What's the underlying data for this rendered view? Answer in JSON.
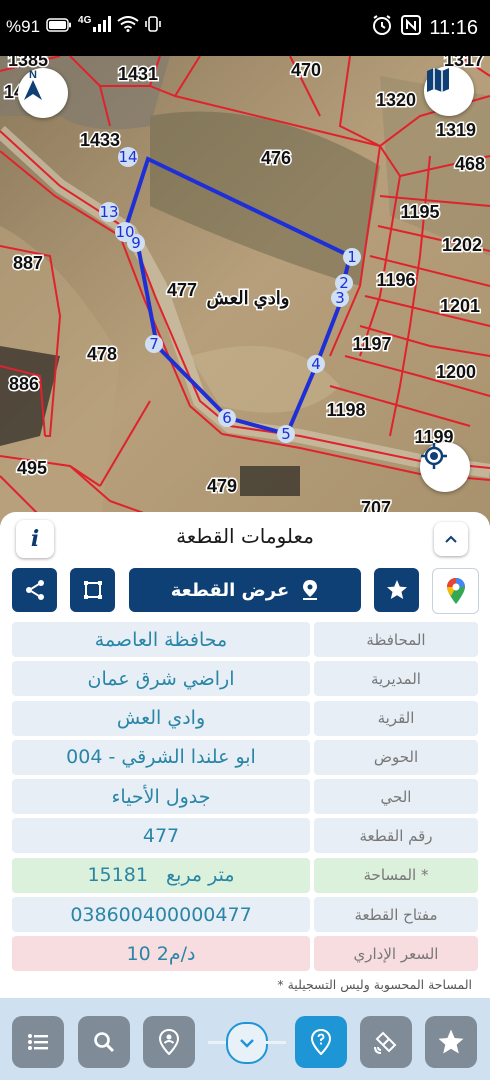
{
  "status_bar": {
    "battery": "%91",
    "network": "4G",
    "time": "11:16"
  },
  "map": {
    "north_label": "N",
    "parcel_labels": [
      "1385",
      "14",
      "1431",
      "470",
      "1317",
      "1320",
      "1319",
      "468",
      "1433",
      "476",
      "1195",
      "1202",
      "887",
      "1196",
      "477",
      "وادي العش",
      "1201",
      "1197",
      "478",
      "1200",
      "886",
      "1198",
      "1199",
      "495",
      "479",
      "707"
    ],
    "vertex_labels": [
      "1",
      "2",
      "3",
      "4",
      "5",
      "6",
      "7",
      "9",
      "10",
      "13",
      "14"
    ]
  },
  "panel": {
    "title": "معلومات القطعة",
    "info_label": "i",
    "show_parcel_label": "عرض القطعة",
    "rows": [
      {
        "label": "المحافظة",
        "value": "محافظة العاصمة"
      },
      {
        "label": "المديرية",
        "value": "اراضي شرق عمان"
      },
      {
        "label": "القرية",
        "value": "وادي العش"
      },
      {
        "label": "الحوض",
        "value": "ابو علندا الشرقي - 004"
      },
      {
        "label": "الحي",
        "value": "جدول الأحياء"
      },
      {
        "label": "رقم القطعة",
        "value": "477"
      },
      {
        "label": "المساحة *",
        "value": "15181   متر مربع"
      },
      {
        "label": "مفتاح القطعة",
        "value": "038600400000477"
      },
      {
        "label": "السعر الإداري",
        "value": "10 د/م2"
      }
    ],
    "footnote": "* المساحة المحسوبة وليس التسجيلية"
  },
  "colors": {
    "primary": "#0e3f75",
    "accent": "#1e96d6",
    "parcel_outline": "#1f2fd6",
    "boundary": "#e0222c"
  },
  "icons": [
    "share-icon",
    "crop-icon",
    "location-pin-icon",
    "star-icon",
    "google-maps-icon",
    "map-book-icon",
    "gps-target-icon",
    "chevron-up-icon",
    "list-icon",
    "search-icon",
    "person-pin-icon",
    "chevron-down-icon",
    "help-pin-icon",
    "satellite-icon",
    "home-star-icon"
  ]
}
